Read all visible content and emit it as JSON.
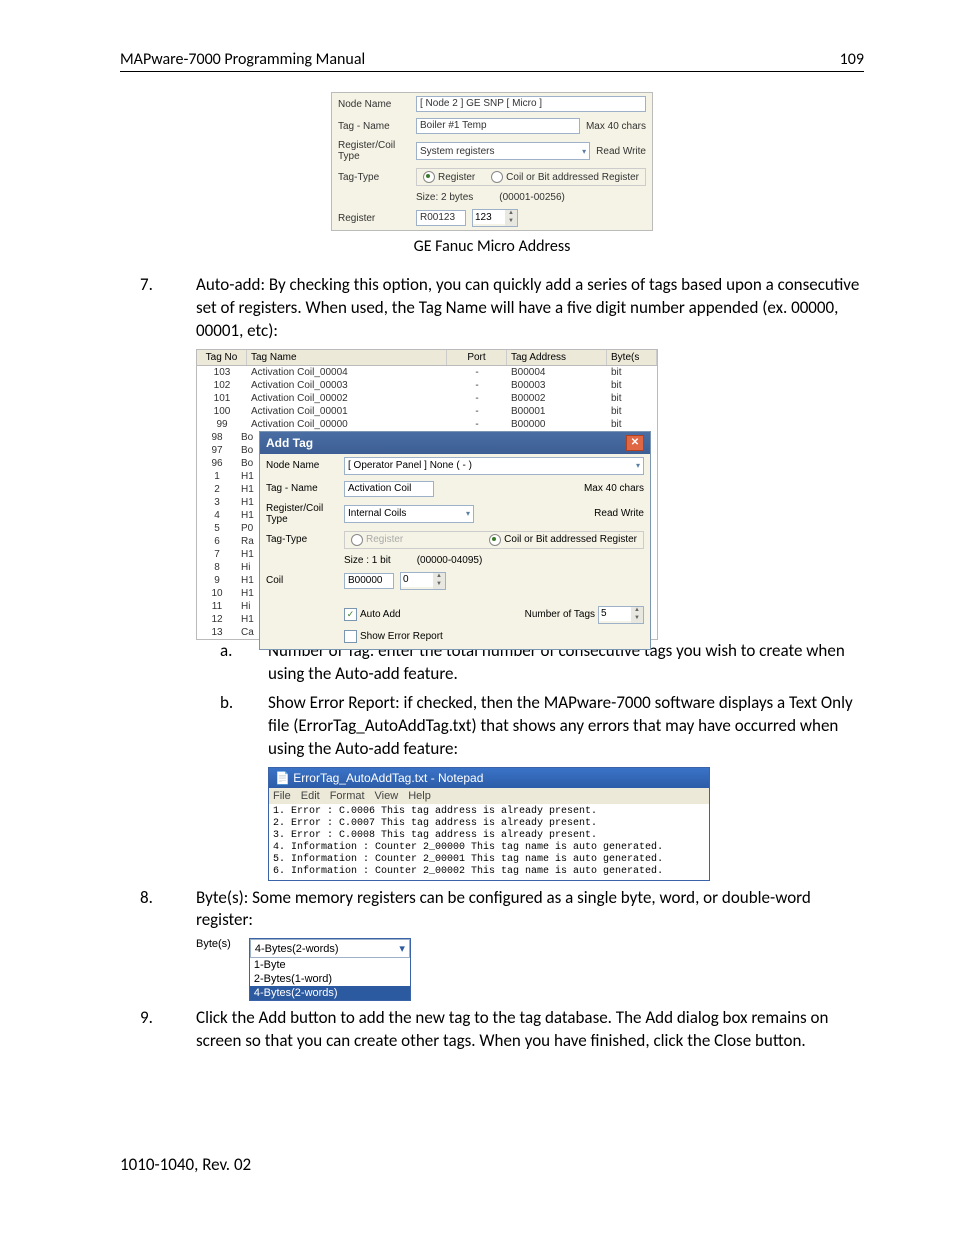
{
  "header": {
    "title": "MAPware-7000 Programming Manual",
    "page": "109"
  },
  "footer": "1010-1040, Rev. 02",
  "dlg1": {
    "labels": {
      "node": "Node Name",
      "tagname": "Tag - Name",
      "regcoil": "Register/Coil Type",
      "tagtype": "Tag-Type",
      "register": "Register"
    },
    "node_val": "[ Node 2 ] GE SNP [ Micro ]",
    "tagname_val": "Boiler #1 Temp",
    "max40": "Max 40 chars",
    "regcoil_val": "System registers",
    "rw": "Read Write",
    "radio_register": "Register",
    "radio_coil": "Coil or Bit addressed Register",
    "size": "Size: 2 bytes",
    "range": "(00001-00256)",
    "reg_val": "R00123",
    "num_val": "123"
  },
  "caption1": "GE Fanuc Micro Address",
  "body": {
    "item7_num": "7.",
    "item7": "Auto-add:  By checking this option, you can quickly add a series of tags based upon a consecutive set of registers.  When used, the Tag Name will have a five digit number appended (ex. 00000, 00001, etc):",
    "item7a_num": "a.",
    "item7a": "Number of Tag: enter the total number of consecutive tags you wish to create when using the Auto-add feature.",
    "item7b_num": "b.",
    "item7b": "Show Error Report: if checked, then the MAPware-7000 software displays a Text Only file (ErrorTag_AutoAddTag.txt) that shows any errors that may have occurred when using the Auto-add feature:",
    "item8_num": "8.",
    "item8": "Byte(s):  Some memory registers can be configured as a single byte, word, or double-word register:",
    "item9_num": "9.",
    "item9": "Click the Add button to add the new tag to the tag database.  The Add dialog box remains on screen so that you can create other tags.  When you have finished, click the Close button."
  },
  "table": {
    "headers": {
      "tagno": "Tag No",
      "tagname": "Tag Name",
      "port": "Port",
      "tagaddr": "Tag Address",
      "bytes": "Byte(s"
    },
    "rows": [
      {
        "no": "103",
        "name": "Activation Coil_00004",
        "port": "-",
        "addr": "B00004",
        "b": "bit"
      },
      {
        "no": "102",
        "name": "Activation Coil_00003",
        "port": "-",
        "addr": "B00003",
        "b": "bit"
      },
      {
        "no": "101",
        "name": "Activation Coil_00002",
        "port": "-",
        "addr": "B00002",
        "b": "bit"
      },
      {
        "no": "100",
        "name": "Activation Coil_00001",
        "port": "-",
        "addr": "B00001",
        "b": "bit"
      },
      {
        "no": "99",
        "name": "Activation Coil_00000",
        "port": "-",
        "addr": "B00000",
        "b": "bit"
      }
    ],
    "partial_nos": [
      "98",
      "97",
      "96",
      "1",
      "2",
      "3",
      "4",
      "5",
      "6",
      "7",
      "8",
      "9",
      "10",
      "11",
      "12",
      "13"
    ],
    "partial_names": [
      "Bo",
      "Bo",
      "Bo",
      "H1",
      "H1",
      "H1",
      "H1",
      "P0",
      "Ra",
      "H1",
      "Hi",
      "H1",
      "H1",
      "Hi",
      "H1",
      "Ca"
    ]
  },
  "addtag": {
    "title": "Add Tag",
    "labels": {
      "node": "Node Name",
      "tagname": "Tag - Name",
      "regcoil": "Register/Coil Type",
      "tagtype": "Tag-Type",
      "coil": "Coil"
    },
    "node_val": "[ Operator Panel ] None ( - )",
    "tagname_val": "Activation Coil",
    "max40": "Max 40 chars",
    "regcoil_val": "Internal Coils",
    "rw": "Read Write",
    "radio_register": "Register",
    "radio_coil": "Coil or Bit addressed Register",
    "size": "Size : 1 bit",
    "range": "(00000-04095)",
    "coil_val": "B00000",
    "num_val": "0",
    "autoadd": "Auto Add",
    "numtags_label": "Number of Tags",
    "numtags_val": "5",
    "showerr": "Show Error Report"
  },
  "notepad": {
    "title": "ErrorTag_AutoAddTag.txt - Notepad",
    "menu": [
      "File",
      "Edit",
      "Format",
      "View",
      "Help"
    ],
    "lines": [
      "1. Error : C.0006 This tag address is already present.",
      "2. Error : C.0007 This tag address is already present.",
      "3. Error : C.0008 This tag address is already present.",
      "4. Information : Counter 2_00000 This tag name is auto generated.",
      "5. Information : Counter 2_00001 This tag name is auto generated.",
      "6. Information : Counter 2_00002 This tag name is auto generated."
    ]
  },
  "bytes": {
    "label": "Byte(s)",
    "selected": "4-Bytes(2-words)",
    "options": [
      "1-Byte",
      "2-Bytes(1-word)",
      "4-Bytes(2-words)"
    ]
  }
}
